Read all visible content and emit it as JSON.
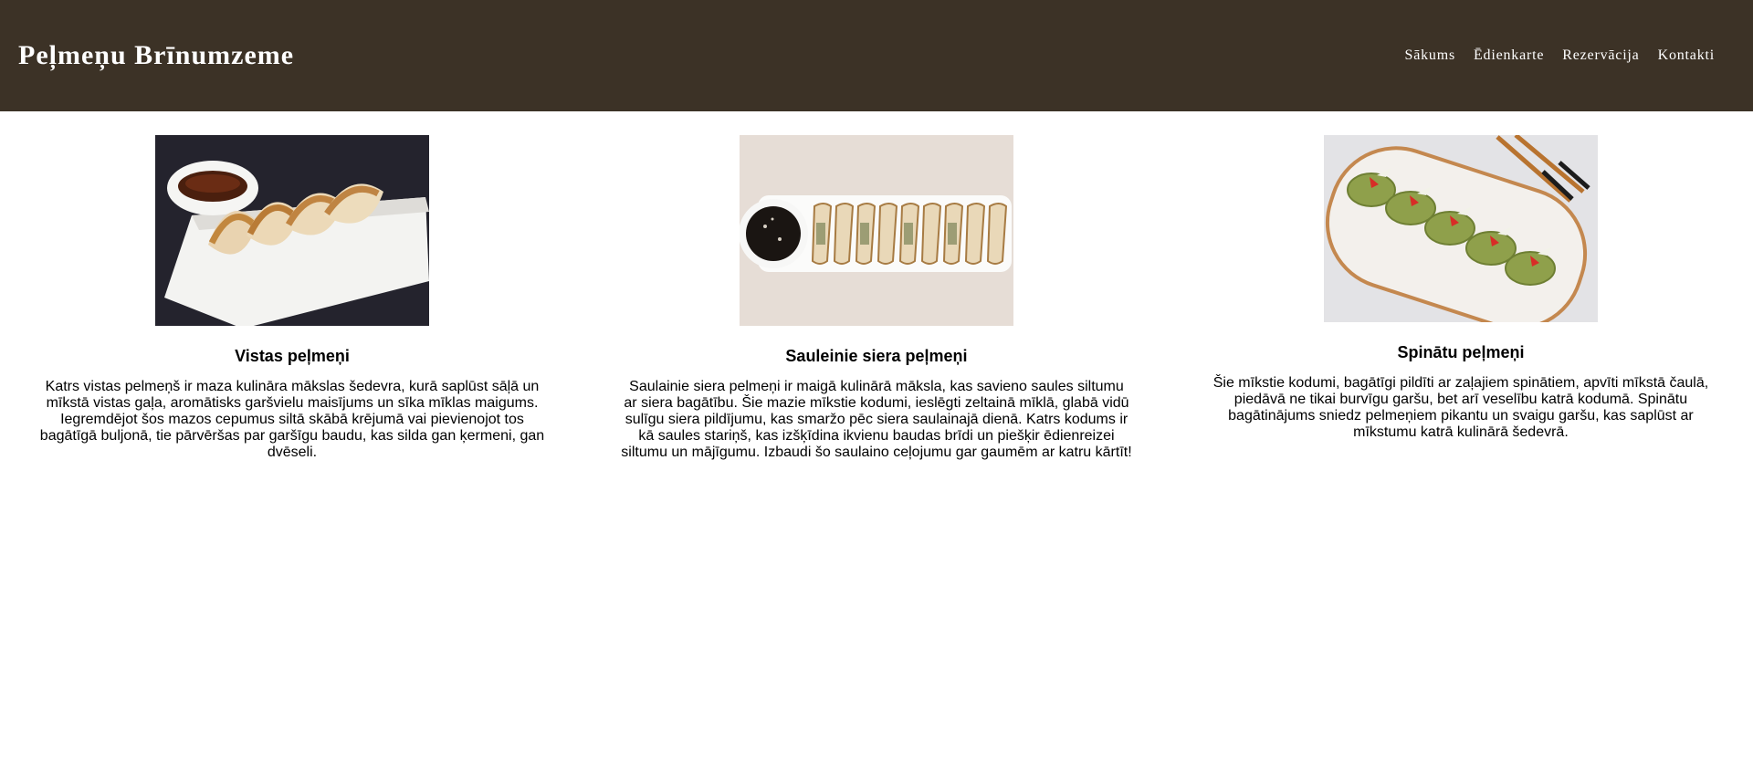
{
  "header": {
    "site_title": "Peļmeņu Brīnumzeme",
    "nav": [
      "Sākums",
      "Ēdienkarte",
      "Rezervācija",
      "Kontakti"
    ]
  },
  "cards": [
    {
      "title": "Vistas peļmeņi",
      "description": "Katrs vistas pelmeņš ir maza kulināra mākslas šedevra, kurā saplūst sāļā un mīkstā vistas gaļa, aromātisks garšvielu maisījums un sīka mīklas maigums. Iegremdējot šos mazos cepumus siltā skābā krējumā vai pievienojot tos bagātīgā buljonā, tie pārvēršas par garšīgu baudu, kas silda gan ķermeni, gan dvēseli."
    },
    {
      "title": "Sauleinie siera peļmeņi",
      "description": "Saulainie siera pelmeņi ir maigā kulinārā māksla, kas savieno saules siltumu ar siera bagātību. Šie mazie mīkstie kodumi, ieslēgti zeltainā mīklā, glabā vidū sulīgu siera pildījumu, kas smaržo pēc siera saulainajā dienā. Katrs kodums ir kā saules stariņš, kas izšķīdina ikvienu baudas brīdi un piešķir ēdienreizei siltumu un mājīgumu. Izbaudi šo saulaino ceļojumu gar gaumēm ar katru kārtīt!"
    },
    {
      "title": "Spinātu peļmeņi",
      "description": "Šie mīkstie kodumi, bagātīgi pildīti ar zaļajiem spinātiem, apvīti mīkstā čaulā, piedāvā ne tikai burvīgu garšu, bet arī veselību katrā kodumā. Spinātu bagātinājums sniedz pelmeņiem pikantu un svaigu garšu, kas saplūst ar mīkstumu katrā kulinārā šedevrā."
    }
  ],
  "colors": {
    "header_bg": "#3c3226",
    "header_text": "#ffffff"
  }
}
